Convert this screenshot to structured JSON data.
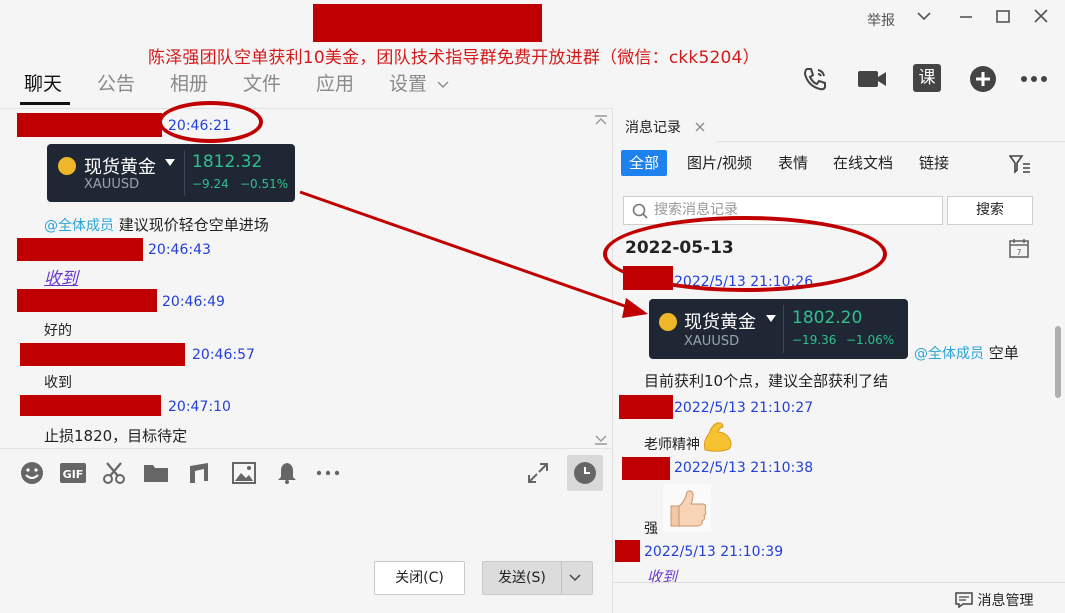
{
  "window": {
    "report_label": "举报",
    "banner": "陈泽强团队空单获利10美金，团队技术指导群免费开放进群（微信：ckk5204）"
  },
  "tabs": [
    {
      "label": "聊天"
    },
    {
      "label": "公告"
    },
    {
      "label": "相册"
    },
    {
      "label": "文件"
    },
    {
      "label": "应用"
    },
    {
      "label": "设置"
    }
  ],
  "toolbar_icons": {
    "course_label": "课"
  },
  "chat": {
    "messages": [
      {
        "time": "20:46:21"
      },
      {
        "time": "20:46:43",
        "text": "收到"
      },
      {
        "time": "20:46:49",
        "text": "好的"
      },
      {
        "time": "20:46:57",
        "text": "收到"
      },
      {
        "time": "20:47:10",
        "text": "止损1820，目标待定"
      }
    ],
    "mention": "@全体成员",
    "advice": "建议现价轻仓空单进场",
    "card": {
      "name": "现货黄金",
      "symbol": "XAUUSD",
      "price": "1812.32",
      "change": "−9.24",
      "change_pct": "−0.51%"
    }
  },
  "buttons": {
    "close": "关闭(C)",
    "send": "发送(S)"
  },
  "history": {
    "tab_label": "消息记录",
    "filters": [
      "全部",
      "图片/视频",
      "表情",
      "在线文档",
      "链接"
    ],
    "search_placeholder": "搜索消息记录",
    "search_button": "搜索",
    "date": "2022-05-13",
    "entries": [
      {
        "time": "2022/5/13 21:10:26"
      },
      {
        "time": "2022/5/13 21:10:27",
        "text": "老师精神"
      },
      {
        "time": "2022/5/13 21:10:38",
        "text": "强"
      },
      {
        "time": "2022/5/13 21:10:39",
        "text": "收到"
      }
    ],
    "mention": "@全体成员",
    "mention_tail": "空单",
    "result": "目前获利10个点，建议全部获利了结",
    "card": {
      "name": "现货黄金",
      "symbol": "XAUUSD",
      "price": "1802.20",
      "change": "−19.36",
      "change_pct": "−1.06%"
    },
    "manage": "消息管理"
  },
  "colors": {
    "accent": "#1e82ee",
    "time_blue": "#2340d8",
    "redact": "#c00000",
    "gain_green": "#2fc08c",
    "banner_red": "#d41a1a"
  }
}
